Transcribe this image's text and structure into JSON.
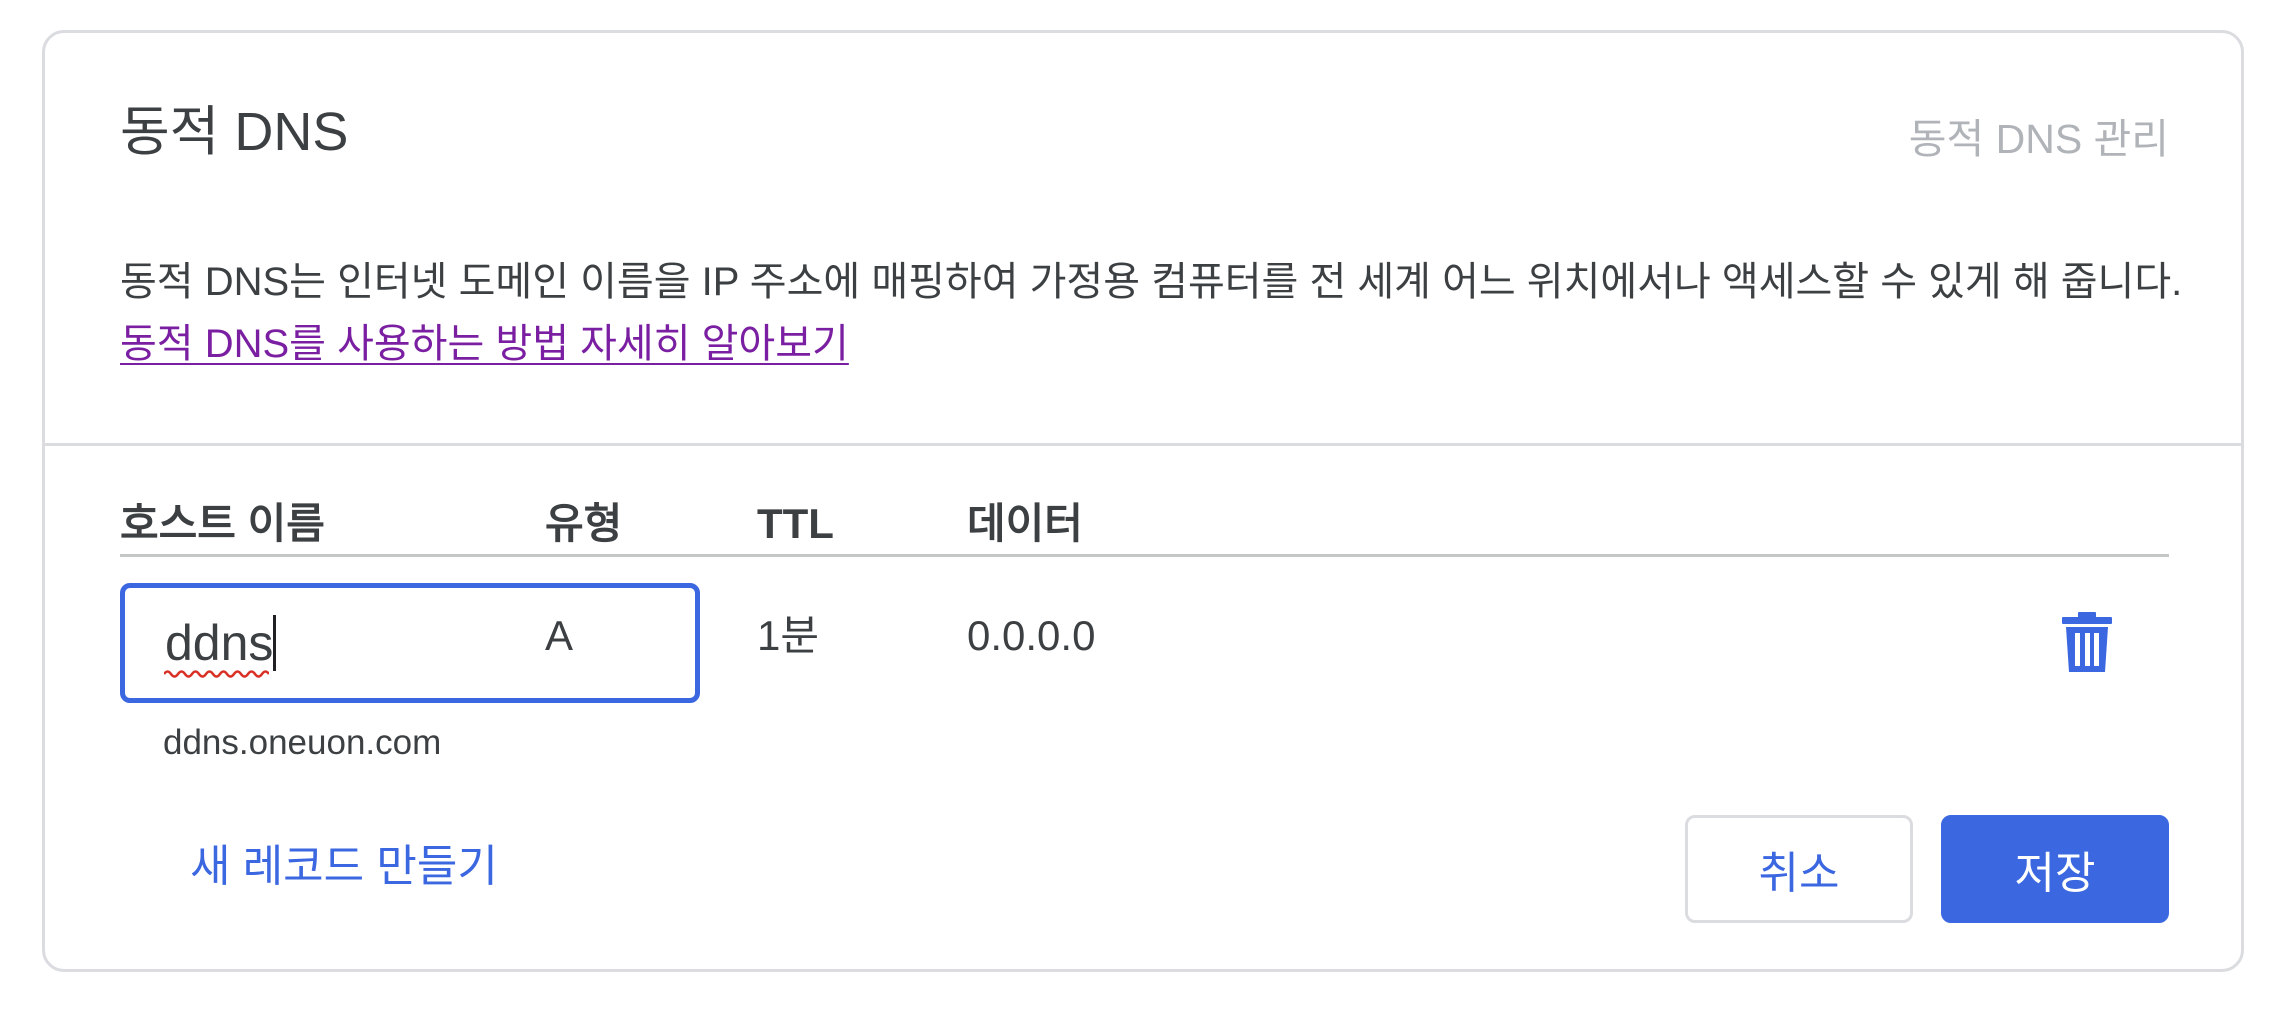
{
  "card": {
    "title": "동적 DNS",
    "manage_link": "동적 DNS 관리",
    "description": "동적 DNS는 인터넷 도메인 이름을 IP 주소에 매핑하여 가정용 컴퓨터를 전 세계 어느 위치에서나 액세스할 수 있게 해 줍니다.",
    "learn_more_link": "동적 DNS를 사용하는 방법 자세히 알아보기"
  },
  "table": {
    "headers": {
      "host": "호스트 이름",
      "type": "유형",
      "ttl": "TTL",
      "data": "데이터"
    },
    "row": {
      "host_value": "ddns",
      "host_full": "ddns.oneuon.com",
      "type": "A",
      "ttl": "1분",
      "data": "0.0.0.0",
      "delete_icon": "trash-icon"
    }
  },
  "actions": {
    "new_record": "새 레코드 만들기",
    "cancel": "취소",
    "save": "저장"
  },
  "colors": {
    "accent": "#3b67e0",
    "link_visited": "#7b1fa2",
    "border": "#dadce0",
    "text": "#3c4043",
    "muted": "#b0b3b8"
  }
}
